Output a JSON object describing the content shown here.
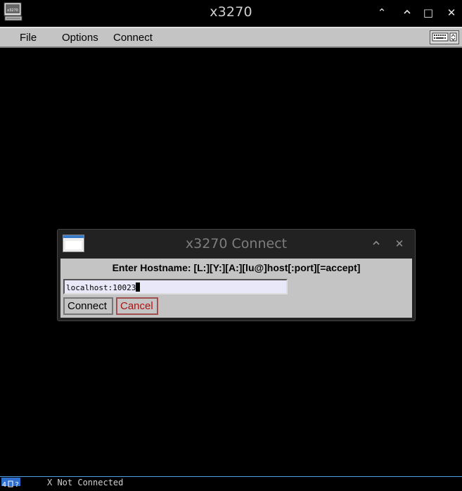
{
  "window": {
    "title": "x3270",
    "controls": {
      "minimize": "⌃",
      "maximize": "□",
      "close": "✕"
    }
  },
  "menubar": {
    "items": [
      {
        "label": "File"
      },
      {
        "label": "Options"
      },
      {
        "label": "Connect"
      }
    ]
  },
  "dialog": {
    "title": "x3270 Connect",
    "controls": {
      "minimize": "⌃",
      "close": "✕"
    },
    "prompt": "Enter Hostname: [L:][Y:][A:][lu@]host[:port][=accept]",
    "host_value": "localhost:10023",
    "connect_label": "Connect",
    "cancel_label": "Cancel"
  },
  "status": {
    "text": "X Not Connected"
  },
  "colors": {
    "terminal_bg": "#000000",
    "chrome_gray": "#c4c4c4",
    "cancel_red": "#b01010",
    "status_blue": "#2f6fd0"
  }
}
